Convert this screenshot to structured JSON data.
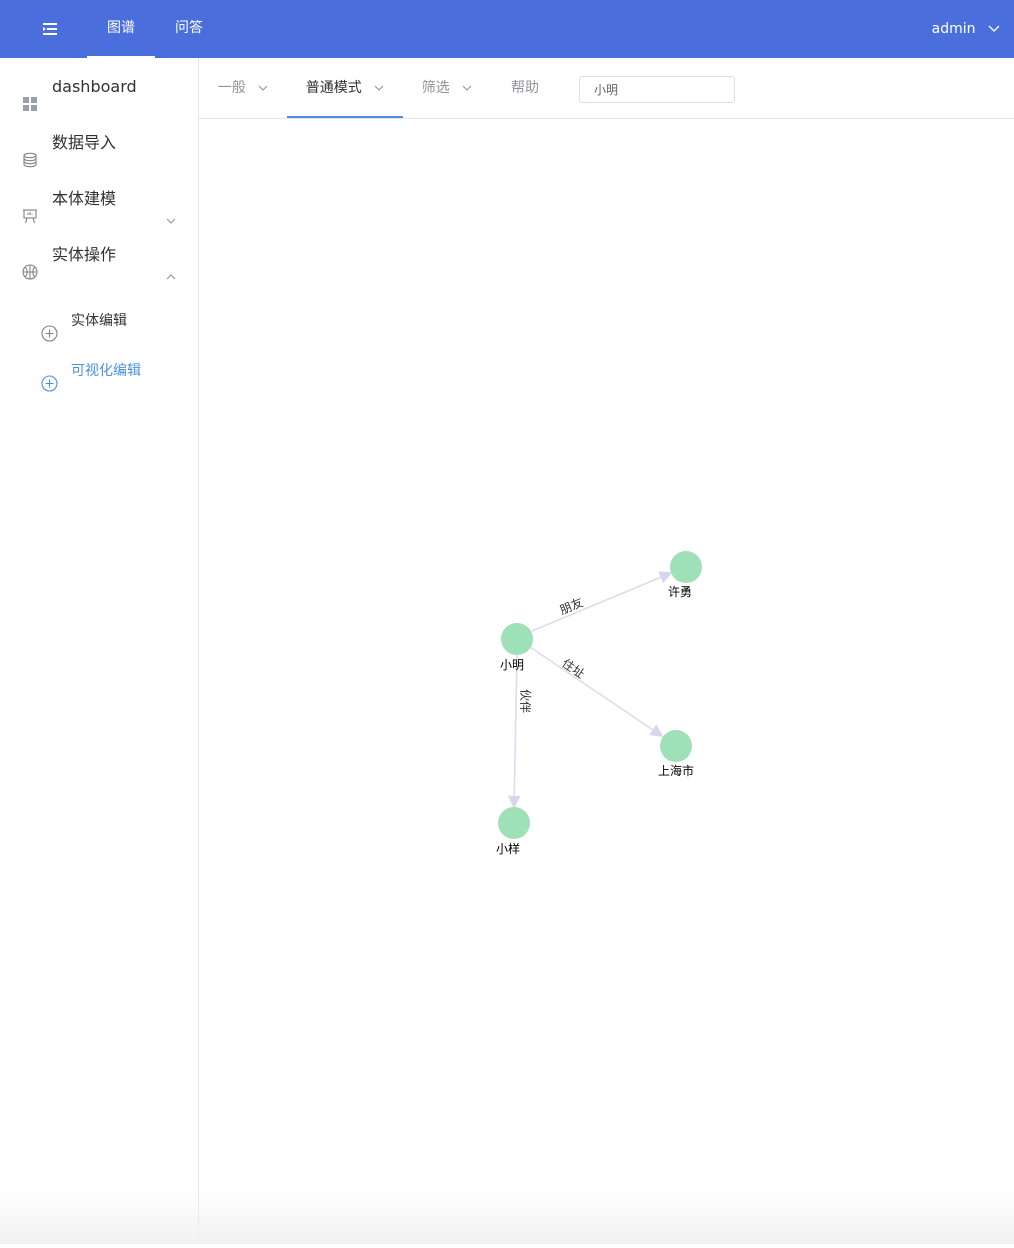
{
  "topbar": {
    "tabs": [
      {
        "label": "图谱"
      },
      {
        "label": "问答"
      }
    ],
    "user": "admin",
    "color": "#4a6fdc"
  },
  "sidebar": {
    "items": [
      {
        "label": "dashboard",
        "icon": "dashboard-icon"
      },
      {
        "label": "数据导入",
        "icon": "database-icon"
      },
      {
        "label": "本体建模",
        "icon": "presentation-icon",
        "expanded": false
      },
      {
        "label": "实体操作",
        "icon": "basketball-icon",
        "expanded": true
      }
    ],
    "subitems": [
      {
        "label": "实体编辑",
        "icon": "circle-plus-icon"
      },
      {
        "label": "可视化编辑",
        "icon": "circle-plus-icon",
        "active": true
      }
    ],
    "active_color": "#4a90e2"
  },
  "toolbar": {
    "items": [
      {
        "label": "一般"
      },
      {
        "label": "普通模式",
        "active": true
      },
      {
        "label": "筛选"
      },
      {
        "label": "帮助"
      }
    ],
    "search_value": "小明"
  },
  "graph": {
    "node_color": "#9ee0b7",
    "edge_color": "#dcdcef",
    "nodes": [
      {
        "id": "xiaoming",
        "label": "小明"
      },
      {
        "id": "xuyong",
        "label": "许勇"
      },
      {
        "id": "shanghai",
        "label": "上海市"
      },
      {
        "id": "xiaoyang",
        "label": "小样"
      }
    ],
    "edges": [
      {
        "from": "xiaoming",
        "to": "xuyong",
        "label": "朋友"
      },
      {
        "from": "xiaoming",
        "to": "shanghai",
        "label": "住址"
      },
      {
        "from": "xiaoming",
        "to": "xiaoyang",
        "label": "伙伴"
      }
    ]
  }
}
